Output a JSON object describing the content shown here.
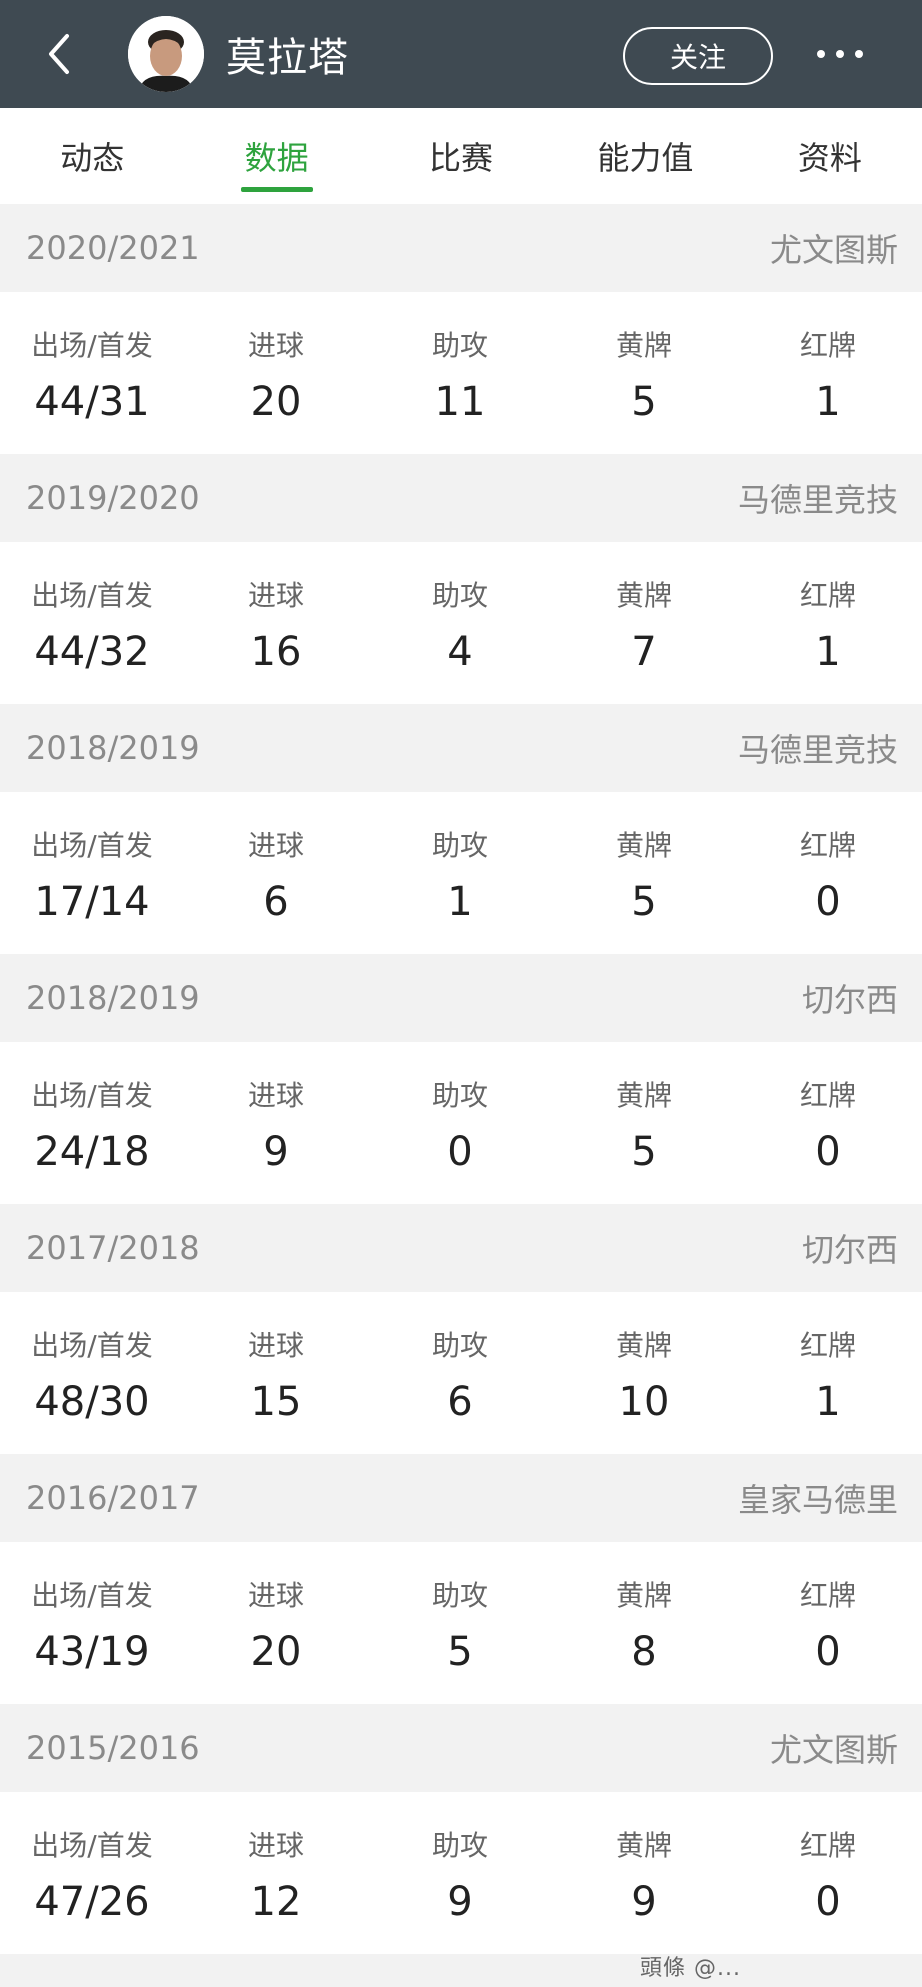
{
  "header": {
    "back_icon": "chevron-left-icon",
    "player_name": "莫拉塔",
    "follow_label": "关注",
    "more_icon": "more-dots-icon"
  },
  "tabs": [
    "动态",
    "数据",
    "比赛",
    "能力值",
    "资料"
  ],
  "active_tab": 1,
  "stat_labels": [
    "出场/首发",
    "进球",
    "助攻",
    "黄牌",
    "红牌"
  ],
  "seasons": [
    {
      "season": "2020/2021",
      "team": "尤文图斯",
      "values": [
        "44/31",
        "20",
        "11",
        "5",
        "1"
      ]
    },
    {
      "season": "2019/2020",
      "team": "马德里竞技",
      "values": [
        "44/32",
        "16",
        "4",
        "7",
        "1"
      ]
    },
    {
      "season": "2018/2019",
      "team": "马德里竞技",
      "values": [
        "17/14",
        "6",
        "1",
        "5",
        "0"
      ]
    },
    {
      "season": "2018/2019",
      "team": "切尔西",
      "values": [
        "24/18",
        "9",
        "0",
        "5",
        "0"
      ]
    },
    {
      "season": "2017/2018",
      "team": "切尔西",
      "values": [
        "48/30",
        "15",
        "6",
        "10",
        "1"
      ]
    },
    {
      "season": "2016/2017",
      "team": "皇家马德里",
      "values": [
        "43/19",
        "20",
        "5",
        "8",
        "0"
      ]
    },
    {
      "season": "2015/2016",
      "team": "尤文图斯",
      "values": [
        "47/26",
        "12",
        "9",
        "9",
        "0"
      ]
    }
  ],
  "watermark": "頭條 @...",
  "colors": {
    "header_bg": "#3f4a52",
    "accent": "#2ea33e"
  }
}
